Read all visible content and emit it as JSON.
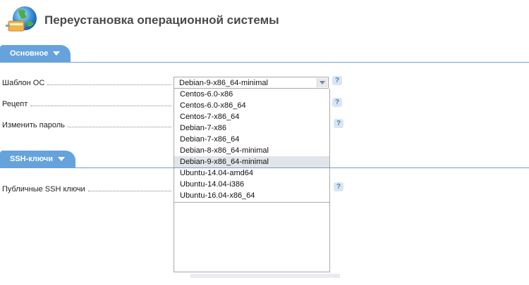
{
  "header": {
    "title": "Переустановка операционной системы"
  },
  "sections": {
    "basic": {
      "label": "Основное"
    },
    "ssh": {
      "label": "SSH-ключи"
    }
  },
  "fields": {
    "os_template": {
      "label": "Шаблон ОС",
      "value": "Debian-9-x86_64-minimal"
    },
    "recipe": {
      "label": "Рецепт"
    },
    "change_password": {
      "label": "Изменить пароль"
    },
    "public_ssh_keys": {
      "label": "Публичные SSH ключи"
    }
  },
  "dropdown": {
    "options": [
      "Centos-6.0-x86",
      "Centos-6.0-x86_64",
      "Centos-7-x86_64",
      "Debian-7-x86",
      "Debian-7-x86_64",
      "Debian-8-x86_64-minimal",
      "Debian-9-x86_64-minimal",
      "Ubuntu-14.04-amd64",
      "Ubuntu-14.04-i386",
      "Ubuntu-16.04-x86_64"
    ],
    "selected_index": 6
  },
  "help": {
    "glyph": "?"
  },
  "colors": {
    "tab": "#66a3dc",
    "section_line": "#6f9fcd",
    "selected_option": "#e1e4e8"
  },
  "icons": {
    "logo": "globe-with-plug-icon",
    "help": "help-icon",
    "caret": "caret-down-icon",
    "select_arrow": "chevron-down-icon"
  }
}
